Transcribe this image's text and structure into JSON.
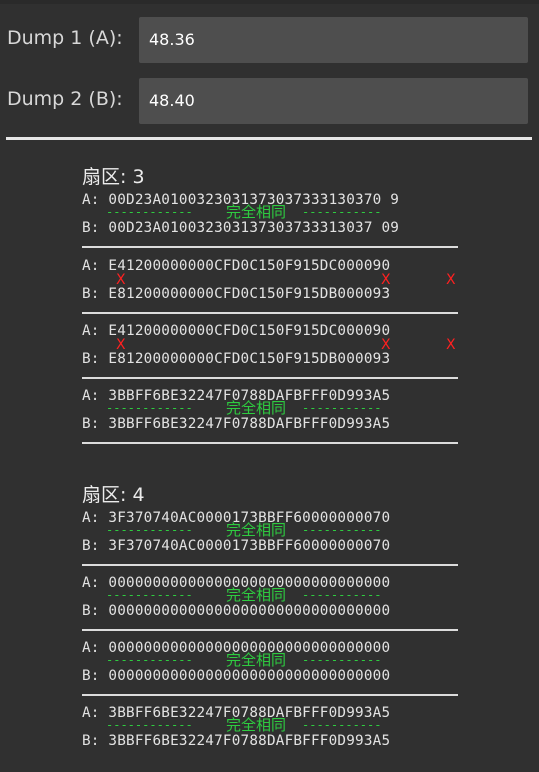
{
  "dump1": {
    "label": "Dump 1 (A):",
    "value": "48.36"
  },
  "dump2": {
    "label": "Dump 2 (B):",
    "value": "48.40"
  },
  "same_text": "完全相同",
  "dashes_left": "------------",
  "dashes_right": "-----------",
  "mismatch_mark": "X",
  "sectors": [
    {
      "title": "扇区: 3",
      "blocks": [
        {
          "a": "A: 00D23A0100323031373037333130370 9",
          "b": "B: 00D23A010032303137303733313037 09",
          "same": true
        },
        {
          "a": "A: E41200000000CFD0C150F915DC000090",
          "b": "B: E81200000000CFD0C150F915DB000093",
          "same": false
        },
        {
          "a": "A: E41200000000CFD0C150F915DC000090",
          "b": "B: E81200000000CFD0C150F915DB000093",
          "same": false
        },
        {
          "a": "A: 3BBFF6BE32247F0788DAFBFFF0D993A5",
          "b": "B: 3BBFF6BE32247F0788DAFBFFF0D993A5",
          "same": true
        }
      ]
    },
    {
      "title": "扇区: 4",
      "blocks": [
        {
          "a": "A: 3F370740AC0000173BBFF60000000070",
          "b": "B: 3F370740AC0000173BBFF60000000070",
          "same": true
        },
        {
          "a": "A: 00000000000000000000000000000000",
          "b": "B: 00000000000000000000000000000000",
          "same": true
        },
        {
          "a": "A: 00000000000000000000000000000000",
          "b": "B: 00000000000000000000000000000000",
          "same": true
        },
        {
          "a": "A: 3BBFF6BE32247F0788DAFBFFF0D993A5",
          "b": "B: 3BBFF6BE32247F0788DAFBFFF0D993A5",
          "same": true
        }
      ]
    }
  ]
}
